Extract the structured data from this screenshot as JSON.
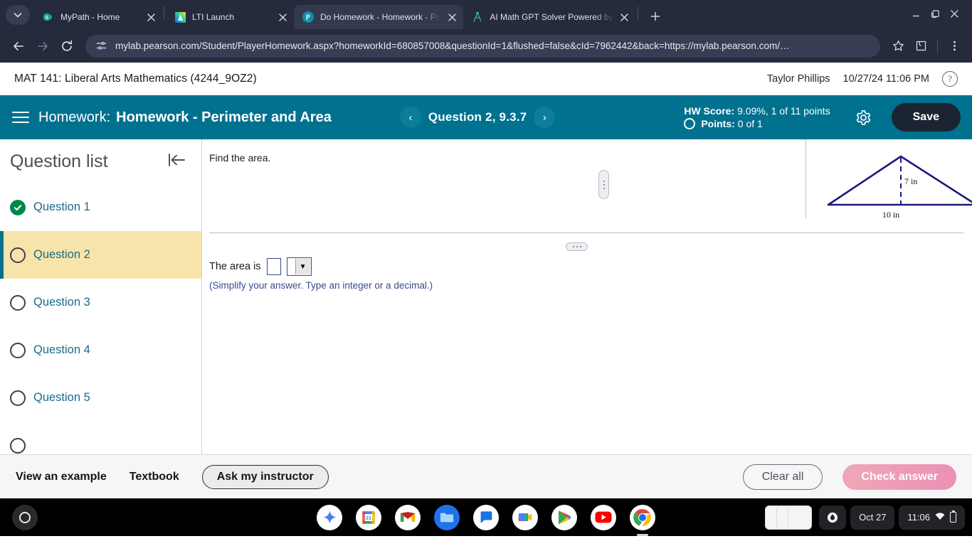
{
  "browser": {
    "tabs": [
      {
        "title": "MyPath - Home",
        "favicon": "sharepoint-icon",
        "active": false
      },
      {
        "title": "LTI Launch",
        "favicon": "lti-icon",
        "active": false
      },
      {
        "title": "Do Homework - Homework - Pe",
        "favicon": "pearson-icon",
        "active": true
      },
      {
        "title": "AI Math GPT Solver Powered by",
        "favicon": "math-gpt-icon",
        "active": false
      }
    ],
    "new_tab_label": "+",
    "url": "mylab.pearson.com/Student/PlayerHomework.aspx?homeworkId=680857008&questionId=1&flushed=false&cId=7962442&back=https://mylab.pearson.com/…",
    "nav": {
      "back": "back-arrow",
      "forward": "forward-arrow",
      "reload": "reload-icon"
    },
    "omnibox_icon": "site-settings-icon",
    "actions": [
      "bookmark-star-icon",
      "extensions-icon",
      "profile-icon",
      "chrome-menu-icon"
    ],
    "window": [
      "minimize",
      "maximize",
      "close"
    ]
  },
  "app_header": {
    "course_title": "MAT 141: Liberal Arts Mathematics (4244_9OZ2)",
    "user_name": "Taylor Phillips",
    "date_time": "10/27/24 11:06 PM",
    "help_label": "?"
  },
  "hw_bar": {
    "menu_icon": "hamburger-icon",
    "label": "Homework:",
    "title": "Homework - Perimeter and Area",
    "prev_label": "‹",
    "next_label": "›",
    "question_label": "Question 2, 9.3.7",
    "hw_score_label": "HW Score:",
    "hw_score_value": "9.09%, 1 of 11 points",
    "points_label": "Points:",
    "points_value": "0 of 1",
    "settings_icon": "gear-icon",
    "save_label": "Save",
    "accent": "#00718e"
  },
  "sidebar": {
    "title": "Question list",
    "collapse_icon": "collapse-panel-icon",
    "items": [
      {
        "label": "Question 1",
        "status": "done"
      },
      {
        "label": "Question 2",
        "status": "current"
      },
      {
        "label": "Question 3",
        "status": "todo"
      },
      {
        "label": "Question 4",
        "status": "todo"
      },
      {
        "label": "Question 5",
        "status": "todo"
      }
    ]
  },
  "question": {
    "prompt": "Find the area.",
    "answer_prefix": "The area is",
    "answer_value": "",
    "unit_selected": "",
    "unit_arrow": "▼",
    "hint": "(Simplify your answer. Type an integer or a decimal.)",
    "figure": {
      "type": "triangle",
      "height_label": "7 in",
      "base_label": "10 in",
      "stroke": "#1a1a7a"
    }
  },
  "footer": {
    "view_example": "View an example",
    "textbook": "Textbook",
    "ask_instructor": "Ask my instructor",
    "clear_all": "Clear all",
    "check_answer": "Check answer"
  },
  "shelf": {
    "launcher": "launcher-icon",
    "apps": [
      "gemini-icon",
      "google-calendar-icon",
      "gmail-icon",
      "files-icon",
      "google-chat-icon",
      "google-meet-icon",
      "play-store-icon",
      "youtube-icon",
      "chrome-icon"
    ],
    "tray": {
      "status_icon": "ink-drop-icon",
      "date": "Oct 27",
      "time": "11:06",
      "wifi": "wifi-icon",
      "battery": "battery-icon"
    }
  }
}
